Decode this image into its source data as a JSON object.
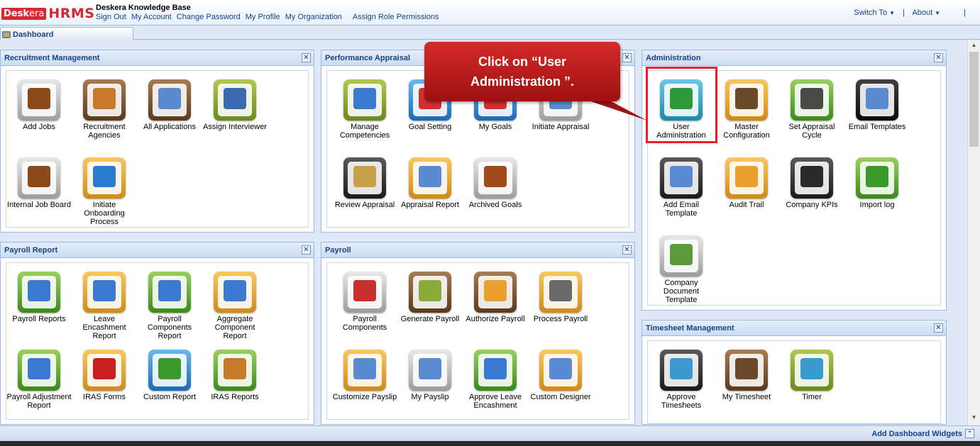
{
  "header": {
    "logo_box": "Desk",
    "logo_suffix": "era",
    "logo_hrms": "HRMS",
    "title": "Deskera Knowledge Base",
    "links": [
      "Sign Out",
      "My Account",
      "Change Password",
      "My Profile",
      "My Organization"
    ],
    "assign_role": "Assign Role Permissions",
    "switch_to": "Switch To",
    "about": "About",
    "separator": "|"
  },
  "tabs": [
    {
      "label": "Dashboard"
    }
  ],
  "callout": {
    "line1": "Click on “User",
    "line2": "Administration ”."
  },
  "panels": {
    "recruitment": {
      "title": "Recruitment Management",
      "items": [
        {
          "label": "Add Jobs",
          "icon": "briefcase-add-icon"
        },
        {
          "label": "Recruitment Agencies",
          "icon": "agency-person-icon"
        },
        {
          "label": "All Applications",
          "icon": "applications-list-icon"
        },
        {
          "label": "Assign Interviewer",
          "icon": "interviewer-icon"
        },
        {
          "label": "Internal Job Board",
          "icon": "job-board-icon"
        },
        {
          "label": "Initiate Onboarding Process",
          "icon": "onboarding-icon"
        }
      ]
    },
    "performance": {
      "title": "Performance Appraisal",
      "items": [
        {
          "label": "Manage Competencies",
          "icon": "competencies-chart-icon"
        },
        {
          "label": "Goal Setting",
          "icon": "target-icon"
        },
        {
          "label": "My Goals",
          "icon": "my-goals-icon"
        },
        {
          "label": "Initiate Appraisal",
          "icon": "initiate-appraisal-icon"
        },
        {
          "label": "Review Appraisal",
          "icon": "review-appraisal-icon"
        },
        {
          "label": "Appraisal Report",
          "icon": "appraisal-report-icon"
        },
        {
          "label": "Archived Goals",
          "icon": "archive-box-icon"
        }
      ]
    },
    "administration": {
      "title": "Administration",
      "items": [
        {
          "label": "User Administration",
          "icon": "user-admin-icon"
        },
        {
          "label": "Master Configuration",
          "icon": "gear-icon"
        },
        {
          "label": "Set Appraisal Cycle",
          "icon": "cycle-clock-icon"
        },
        {
          "label": "Email Templates",
          "icon": "email-template-icon"
        },
        {
          "label": "Add Email Template",
          "icon": "add-email-template-icon"
        },
        {
          "label": "Audit Trail",
          "icon": "folders-icon"
        },
        {
          "label": "Company KPIs",
          "icon": "gauge-icon"
        },
        {
          "label": "Import log",
          "icon": "import-icon"
        },
        {
          "label": "Company Document Template",
          "icon": "documents-icon"
        }
      ]
    },
    "payroll_report": {
      "title": "Payroll Report",
      "items": [
        {
          "label": "Payroll Reports",
          "icon": "payroll-report-icon"
        },
        {
          "label": "Leave Encashment Report",
          "icon": "leave-encashment-icon"
        },
        {
          "label": "Payroll Components Report",
          "icon": "components-report-icon"
        },
        {
          "label": "Aggregate Component Report",
          "icon": "aggregate-report-icon"
        },
        {
          "label": "Payroll Adjustment Report",
          "icon": "adjustment-report-icon"
        },
        {
          "label": "IRAS Forms",
          "icon": "iras-forms-icon"
        },
        {
          "label": "Custom Report",
          "icon": "custom-report-icon"
        },
        {
          "label": "IRAS Reports",
          "icon": "iras-reports-icon"
        }
      ]
    },
    "payroll": {
      "title": "Payroll",
      "items": [
        {
          "label": "Payroll Components",
          "icon": "tools-icon"
        },
        {
          "label": "Generate Payroll",
          "icon": "checklist-icon"
        },
        {
          "label": "Authorize Payroll",
          "icon": "authorize-icon"
        },
        {
          "label": "Process Payroll",
          "icon": "process-payroll-icon"
        },
        {
          "label": "Customize Payslip",
          "icon": "customize-payslip-icon"
        },
        {
          "label": "My Payslip",
          "icon": "payslip-icon"
        },
        {
          "label": "Approve Leave Encashment",
          "icon": "approve-leave-icon"
        },
        {
          "label": "Custom Designer",
          "icon": "designer-icon"
        }
      ]
    },
    "timesheet": {
      "title": "Timesheet Management",
      "items": [
        {
          "label": "Approve Timesheets",
          "icon": "approve-timesheet-icon"
        },
        {
          "label": "My Timesheet",
          "icon": "my-timesheet-icon"
        },
        {
          "label": "Timer",
          "icon": "stopwatch-icon"
        }
      ]
    }
  },
  "footer": {
    "add_widgets": "Add Dashboard Widgets"
  }
}
